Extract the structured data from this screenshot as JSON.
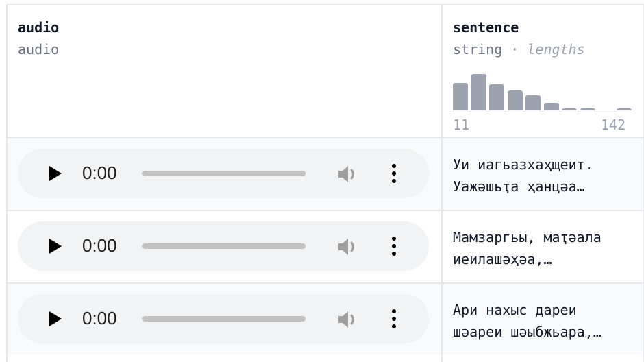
{
  "columns": [
    {
      "name": "audio",
      "type": "audio"
    },
    {
      "name": "sentence",
      "type": "string",
      "stat_label": "lengths",
      "histogram": {
        "min_label": "11",
        "max_label": "142",
        "bins": [
          40,
          53,
          38,
          29,
          22,
          11,
          3,
          3,
          0,
          3
        ]
      }
    }
  ],
  "rows": [
    {
      "audio_time": "0:00",
      "sentence": "Уи иагьазхаҳщеит.\nУажәшьҭа ҳанцәа…"
    },
    {
      "audio_time": "0:00",
      "sentence": "Мамзаргьы, маҭәала\nиеилашәҳәа,…"
    },
    {
      "audio_time": "0:00",
      "sentence": "Ари нахыс дареи\nшәареи шәыбжьара,…"
    }
  ]
}
